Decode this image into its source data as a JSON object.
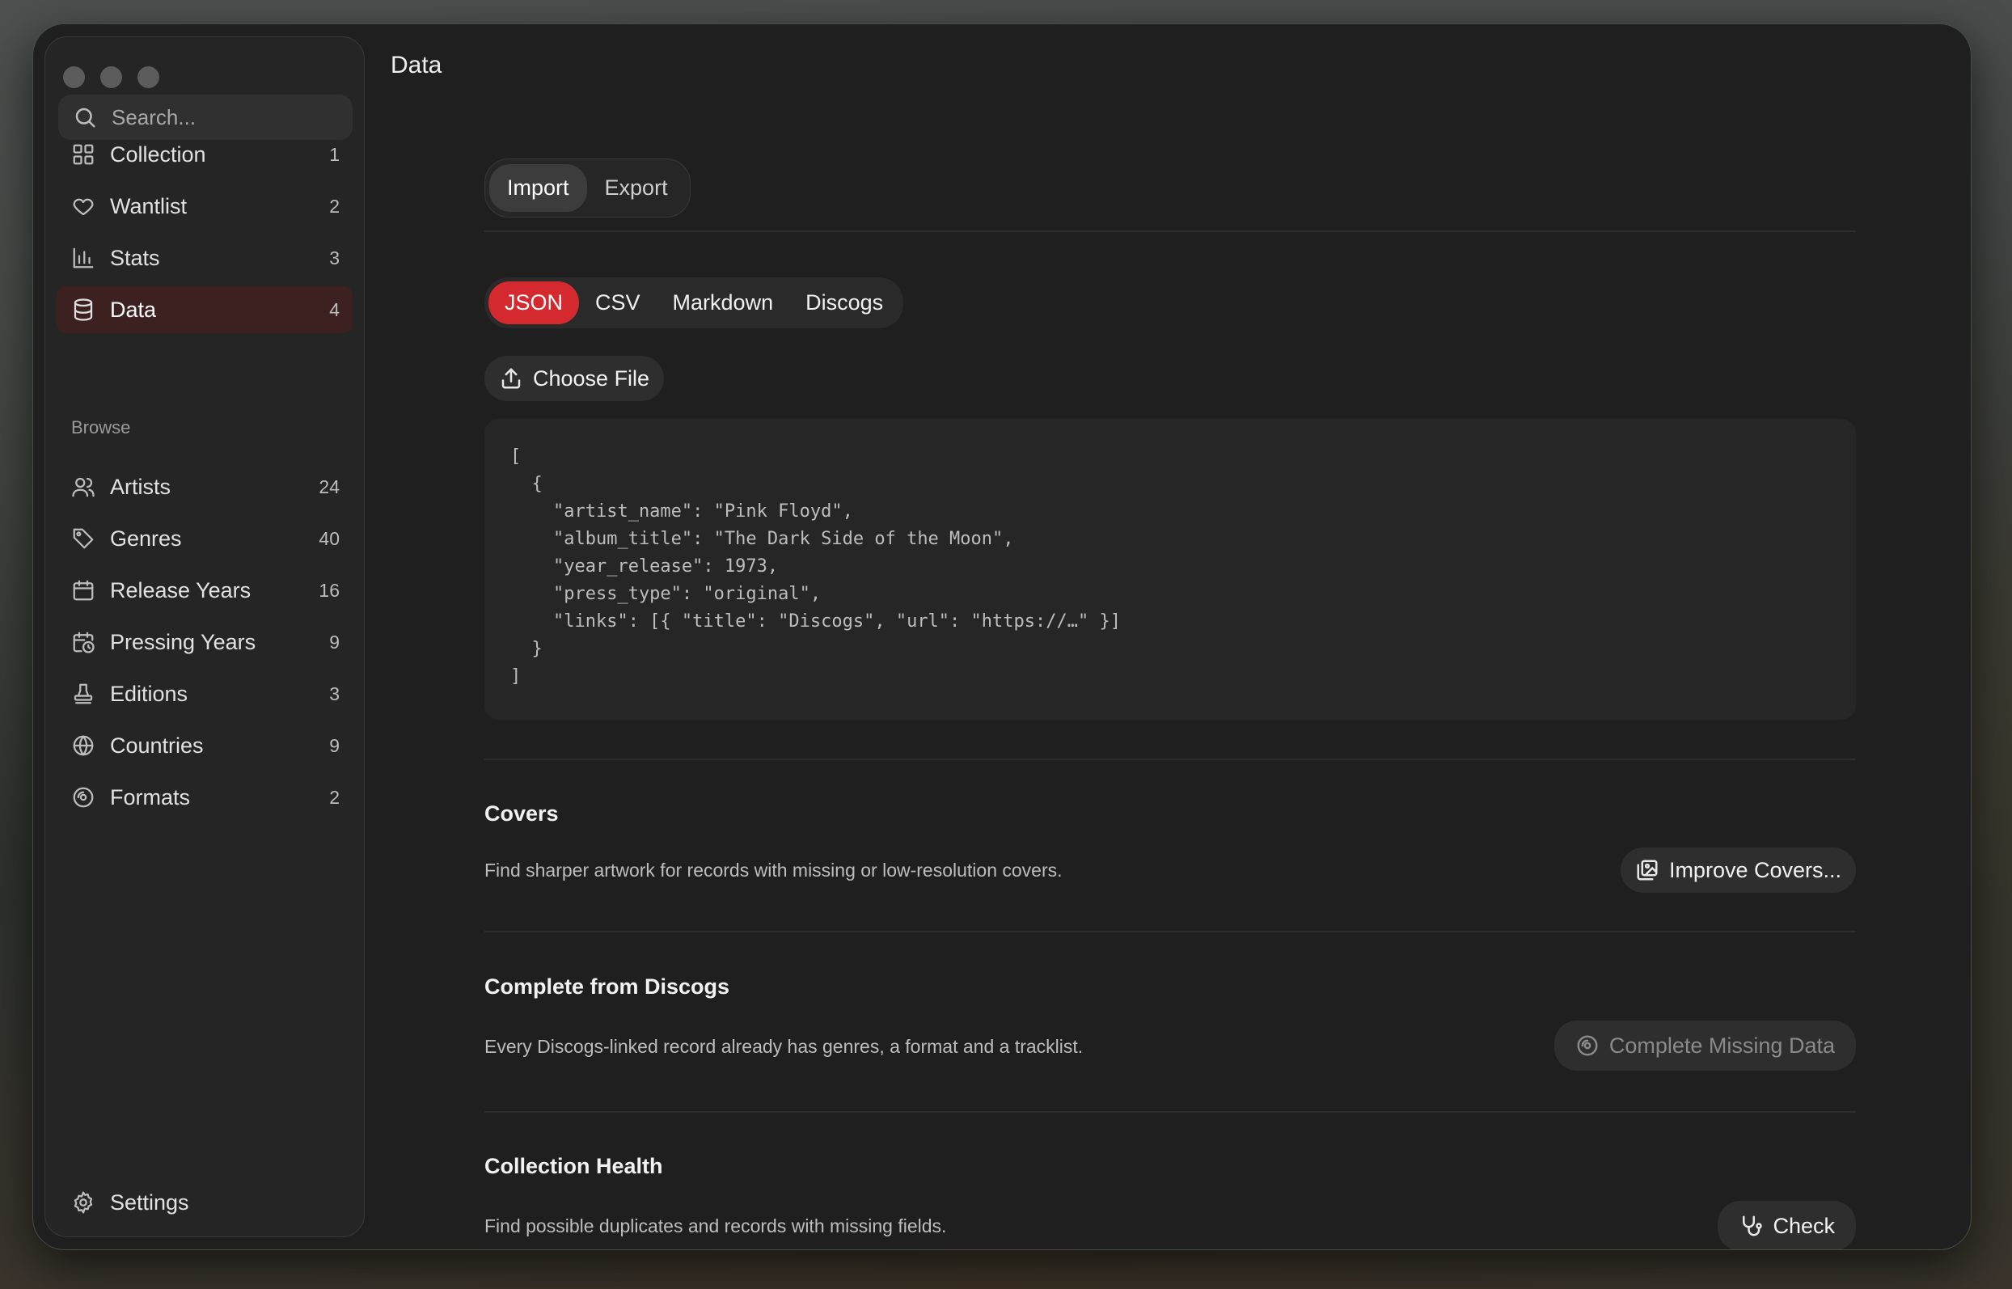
{
  "sidebar": {
    "search_placeholder": "Search...",
    "items": [
      {
        "label": "Collection",
        "count": "1",
        "icon": "grid-icon"
      },
      {
        "label": "Wantlist",
        "count": "2",
        "icon": "heart-icon"
      },
      {
        "label": "Stats",
        "count": "3",
        "icon": "bar-chart-icon"
      },
      {
        "label": "Data",
        "count": "4",
        "icon": "database-icon"
      }
    ],
    "browse_label": "Browse",
    "browse": [
      {
        "label": "Artists",
        "count": "24",
        "icon": "users-icon"
      },
      {
        "label": "Genres",
        "count": "40",
        "icon": "tag-icon"
      },
      {
        "label": "Release Years",
        "count": "16",
        "icon": "calendar-icon"
      },
      {
        "label": "Pressing Years",
        "count": "9",
        "icon": "calendar-clock-icon"
      },
      {
        "label": "Editions",
        "count": "3",
        "icon": "stamp-icon"
      },
      {
        "label": "Countries",
        "count": "9",
        "icon": "globe-icon"
      },
      {
        "label": "Formats",
        "count": "2",
        "icon": "disc-icon"
      }
    ],
    "settings_label": "Settings"
  },
  "main": {
    "title": "Data",
    "mode_tabs": [
      "Import",
      "Export"
    ],
    "format_tabs": [
      "JSON",
      "CSV",
      "Markdown",
      "Discogs"
    ],
    "choose_file_label": "Choose File",
    "code_sample": "[\n  {\n    \"artist_name\": \"Pink Floyd\",\n    \"album_title\": \"The Dark Side of the Moon\",\n    \"year_release\": 1973,\n    \"press_type\": \"original\",\n    \"links\": [{ \"title\": \"Discogs\", \"url\": \"https://…\" }]\n  }\n]",
    "covers": {
      "title": "Covers",
      "desc": "Find sharper artwork for records with missing or low-resolution covers.",
      "button": "Improve Covers..."
    },
    "discogs": {
      "title": "Complete from Discogs",
      "desc": "Every Discogs-linked record already has genres, a format and a tracklist.",
      "button": "Complete Missing Data"
    },
    "health": {
      "title": "Collection Health",
      "desc": "Find possible duplicates and records with missing fields.",
      "button": "Check"
    }
  },
  "colors": {
    "accent": "#d42a2f",
    "active_nav_bg": "#3d2121",
    "window_bg": "#1f1f1f"
  }
}
